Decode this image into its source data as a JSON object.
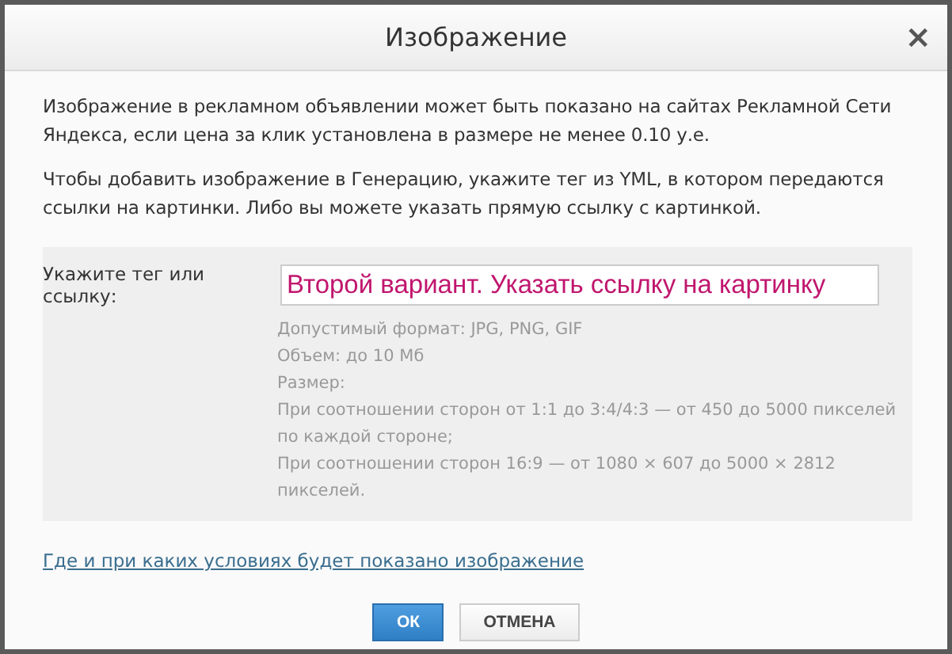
{
  "dialog": {
    "title": "Изображение",
    "close": "×"
  },
  "paragraphs": [
    "Изображение в рекламном объявлении может быть показано на сайтах Рекламной Сети Яндекса, если цена за клик установлена в размере не менее 0.10 у.е.",
    "Чтобы добавить изображение в Генерацию, укажите тег из YML, в котором передаются ссылки на картинки. Либо вы можете указать прямую ссылку с картинкой."
  ],
  "field": {
    "label": "Укажите тег или ссылку:",
    "value": "Второй вариант. Указать ссылку на картинку"
  },
  "hints": [
    "Допустимый формат: JPG, PNG, GIF",
    "Объем: до 10 Мб",
    "Размер:",
    "При соотношении сторон от 1:1 до 3:4/4:3 — от 450 до 5000 пикселей по каждой стороне;",
    "При соотношении сторон 16:9 — от 1080 × 607 до 5000 × 2812 пикселей."
  ],
  "link": "Где и при каких условиях будет показано изображение",
  "buttons": [
    {
      "label": "ОК",
      "kind": "primary"
    },
    {
      "label": "ОТМЕНА",
      "kind": "secondary"
    }
  ]
}
